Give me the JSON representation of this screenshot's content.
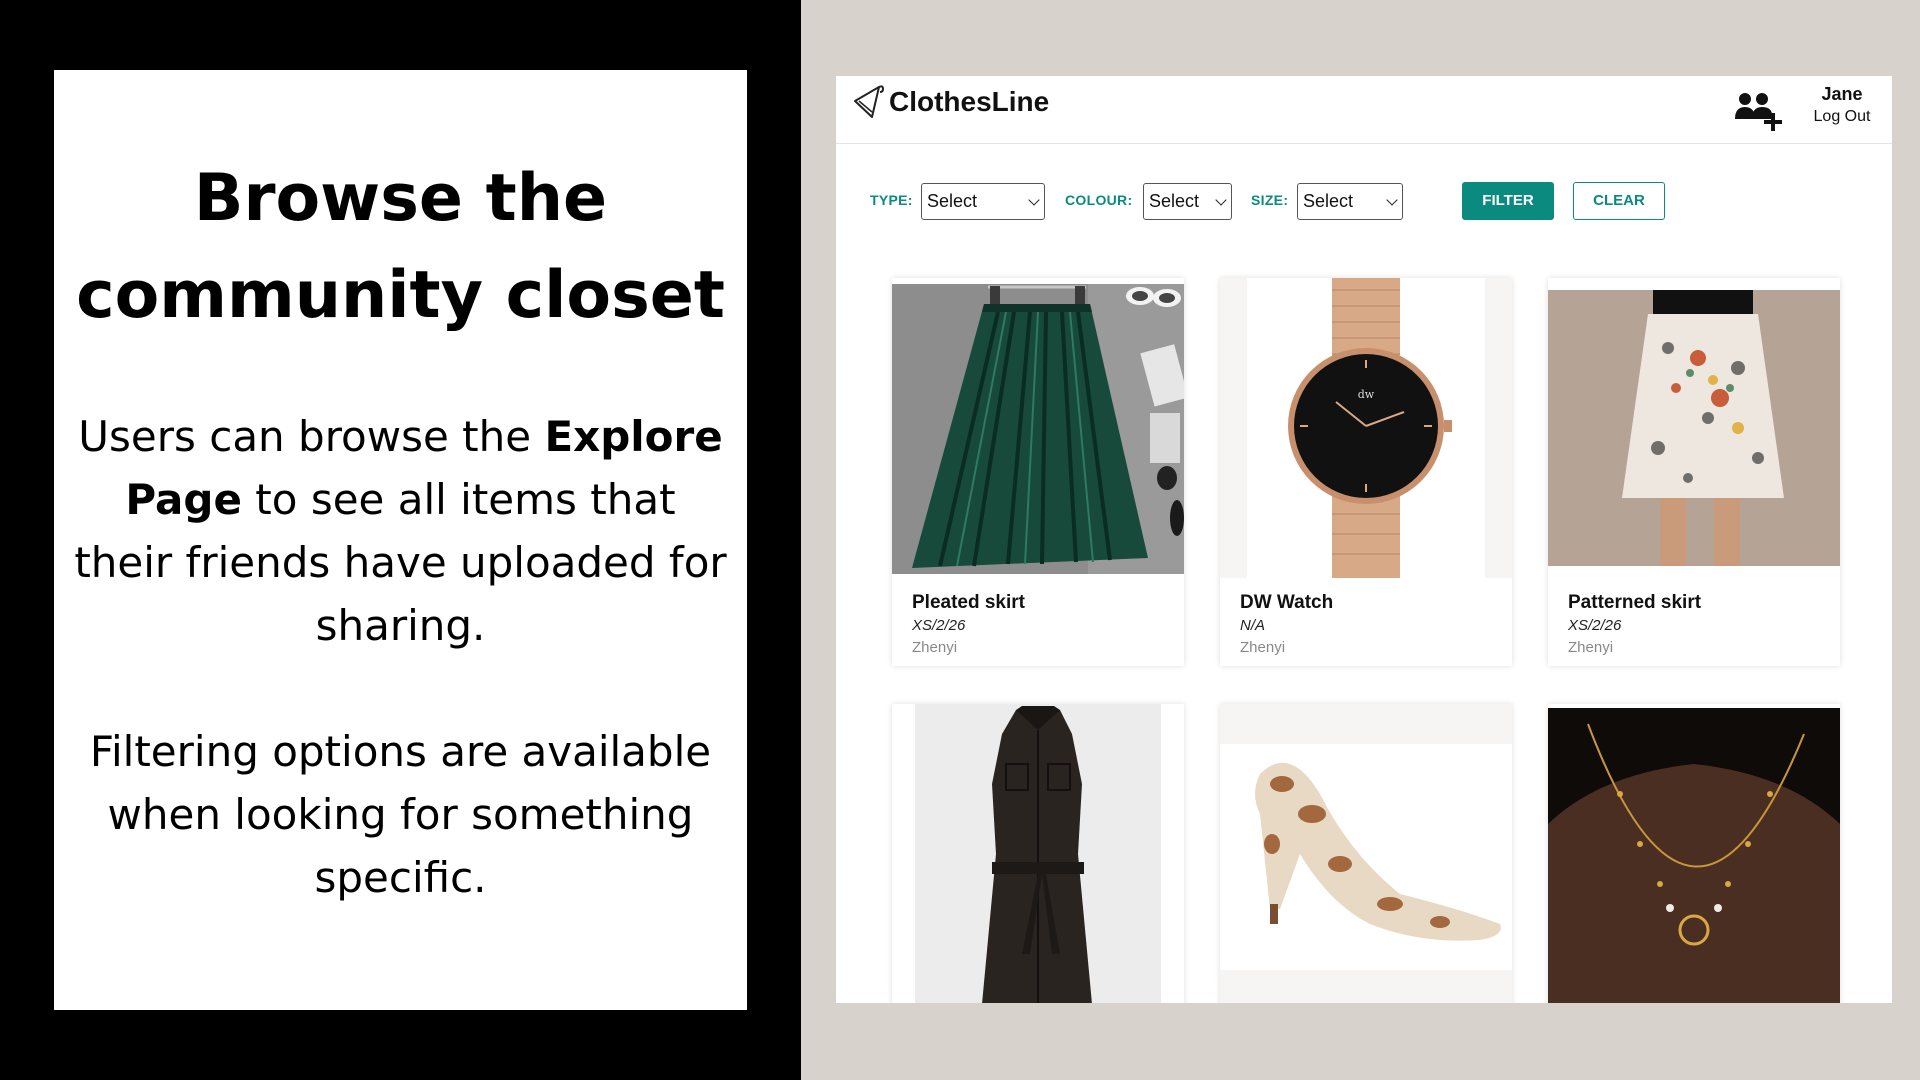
{
  "slide": {
    "heading": "Browse the community closet",
    "paragraph1": {
      "before": "Users can browse the ",
      "bold": "Explore Page",
      "after": " to see all items that their friends have uploaded for sharing."
    },
    "paragraph2": "Filtering options are available when looking for something specific."
  },
  "app": {
    "brand": "ClothesLine",
    "icons": {
      "logo": "clothes-hanger-icon",
      "friends": "add-friend-icon"
    },
    "user": {
      "name": "Jane",
      "logout_label": "Log Out"
    },
    "filters": {
      "type": {
        "label": "TYPE:",
        "value": "Select"
      },
      "colour": {
        "label": "COLOUR:",
        "value": "Select"
      },
      "size": {
        "label": "SIZE:",
        "value": "Select"
      },
      "filter_button": "FILTER",
      "clear_button": "CLEAR"
    },
    "accent_color": "#0b8a7f",
    "items": [
      {
        "name": "Pleated skirt",
        "size": "XS/2/26",
        "owner": "Zhenyi",
        "image": "green-pleated-skirt"
      },
      {
        "name": "DW Watch",
        "size": "N/A",
        "owner": "Zhenyi",
        "image": "rose-gold-watch"
      },
      {
        "name": "Patterned skirt",
        "size": "XS/2/26",
        "owner": "Zhenyi",
        "image": "floral-patterned-skirt"
      },
      {
        "name": "",
        "size": "",
        "owner": "",
        "image": "black-sleeveless-dress"
      },
      {
        "name": "",
        "size": "",
        "owner": "",
        "image": "velvet-high-heel"
      },
      {
        "name": "",
        "size": "",
        "owner": "",
        "image": "gold-necklace"
      }
    ]
  }
}
